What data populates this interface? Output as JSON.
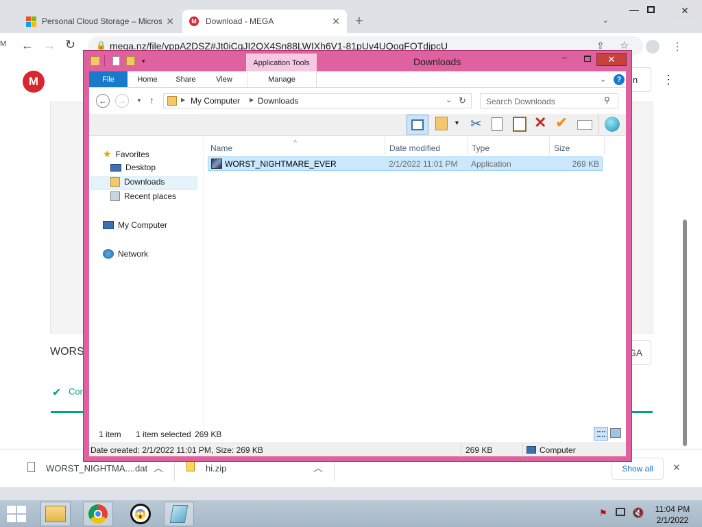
{
  "browser": {
    "tabs": [
      {
        "label": "Personal Cloud Storage – Microsoft",
        "icon": "microsoft-logo-icon"
      },
      {
        "label": "Download - MEGA",
        "icon": "mega-logo-icon"
      }
    ],
    "url": "mega.nz/file/yppA2DSZ#Jt0iCgJI2QX4Sn88LWIXh6V1-81pUv4UQoqFOTdjpcU",
    "edge_text": "M"
  },
  "mega_page": {
    "filename_partial": "WORS",
    "status_partial": "Cor",
    "button_partial": "GA",
    "top_button_partial": "n"
  },
  "explorer": {
    "title": "Downloads",
    "contextual_group": "Application Tools",
    "ribbon_tabs": [
      "File",
      "Home",
      "Share",
      "View",
      "Manage"
    ],
    "breadcrumb": [
      "My Computer",
      "Downloads"
    ],
    "search_placeholder": "Search Downloads",
    "nav": {
      "favorites": "Favorites",
      "desktop": "Desktop",
      "downloads": "Downloads",
      "recent": "Recent places",
      "computer": "My Computer",
      "network": "Network"
    },
    "columns": [
      "Name",
      "Date modified",
      "Type",
      "Size"
    ],
    "files": [
      {
        "name": "WORST_NIGHTMARE_EVER",
        "date": "2/1/2022 11:01 PM",
        "type": "Application",
        "size": "269 KB"
      }
    ],
    "status": {
      "count": "1 item",
      "selected": "1 item selected",
      "selected_size": "269 KB"
    },
    "details": {
      "created": "Date created: 2/1/2022 11:01 PM, Size: 269 KB",
      "size": "269 KB",
      "location": "Computer"
    }
  },
  "downloads_bar": {
    "items": [
      {
        "name": "WORST_NIGHTMA....dat"
      },
      {
        "name": "hi.zip"
      }
    ],
    "show_all": "Show all"
  },
  "clock": {
    "time": "11:04 PM",
    "date": "2/1/2022"
  },
  "colors": {
    "window_frame": "#e0619f",
    "ribbon_file": "#1979ca",
    "mega_red": "#d9272e",
    "selection": "#cce8ff"
  }
}
